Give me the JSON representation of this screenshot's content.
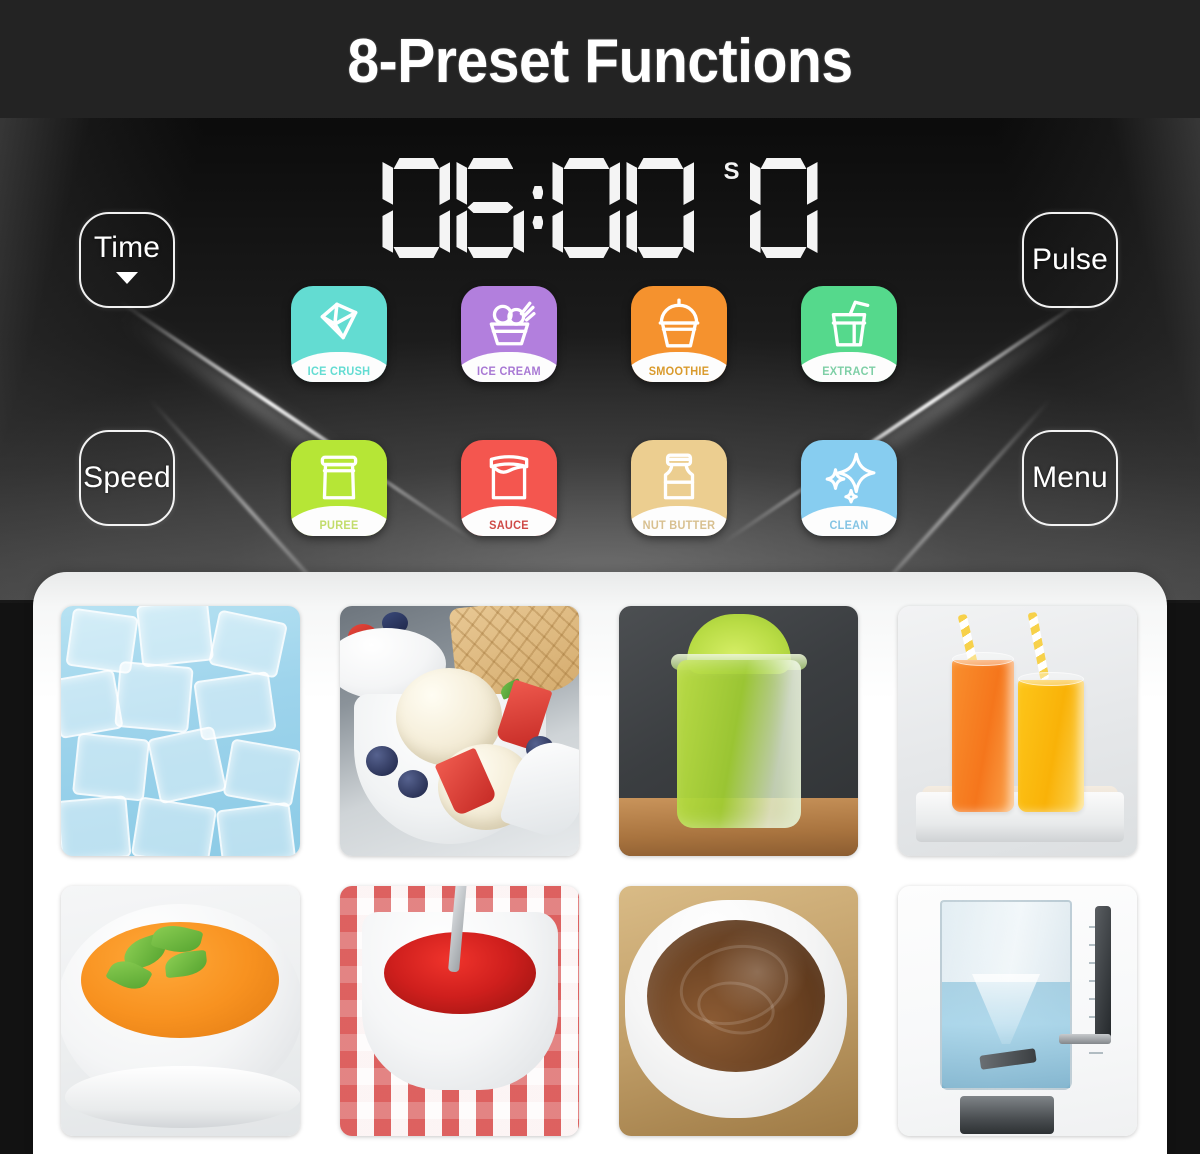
{
  "header": {
    "title": "8-Preset Functions"
  },
  "display": {
    "time_value": "06:00",
    "time_digits": [
      "0",
      "6",
      "0",
      "0"
    ],
    "speed_label": "S",
    "speed_value": "0"
  },
  "controls": [
    {
      "id": "time",
      "label": "Time",
      "icon": "chevron-down-icon",
      "has_arrow": true
    },
    {
      "id": "pulse",
      "label": "Pulse",
      "icon": "",
      "has_arrow": false
    },
    {
      "id": "speed",
      "label": "Speed",
      "icon": "",
      "has_arrow": false
    },
    {
      "id": "menu",
      "label": "Menu",
      "icon": "",
      "has_arrow": false
    }
  ],
  "presets": [
    {
      "label": "ICE CRUSH",
      "icon": "ice-cube-icon",
      "tile_color": "#63dcd2",
      "label_color": "#63dcd2"
    },
    {
      "label": "ICE CREAM",
      "icon": "ice-cream-cup-icon",
      "tile_color": "#b27fdd",
      "label_color": "#a878d4"
    },
    {
      "label": "SMOOTHIE",
      "icon": "domed-cup-icon",
      "tile_color": "#f5922e",
      "label_color": "#d99a2c"
    },
    {
      "label": "EXTRACT",
      "icon": "cup-straw-icon",
      "tile_color": "#55d98c",
      "label_color": "#7ecfa6"
    },
    {
      "label": "PUREE",
      "icon": "jar-icon",
      "tile_color": "#b6e636",
      "label_color": "#c2dc6a"
    },
    {
      "label": "SAUCE",
      "icon": "jam-jar-icon",
      "tile_color": "#f4564f",
      "label_color": "#cf4a46"
    },
    {
      "label": "NUT BUTTER",
      "icon": "butter-jar-icon",
      "tile_color": "#ecce90",
      "label_color": "#d8c090"
    },
    {
      "label": "CLEAN",
      "icon": "sparkle-icon",
      "tile_color": "#87cdf0",
      "label_color": "#84c4e4"
    }
  ],
  "photos": [
    {
      "alt": "crushed ice cubes"
    },
    {
      "alt": "vanilla ice cream scoops with berries and waffle cone"
    },
    {
      "alt": "green smoothie in a mason jar"
    },
    {
      "alt": "two glasses of orange and yellow juice with straws"
    },
    {
      "alt": "carrot puree in a white bowl with cilantro"
    },
    {
      "alt": "red tomato sauce in a white pot with spoon"
    },
    {
      "alt": "chocolate nut butter spread in a white bowl"
    },
    {
      "alt": "blender jar filled with water for cleaning"
    }
  ]
}
